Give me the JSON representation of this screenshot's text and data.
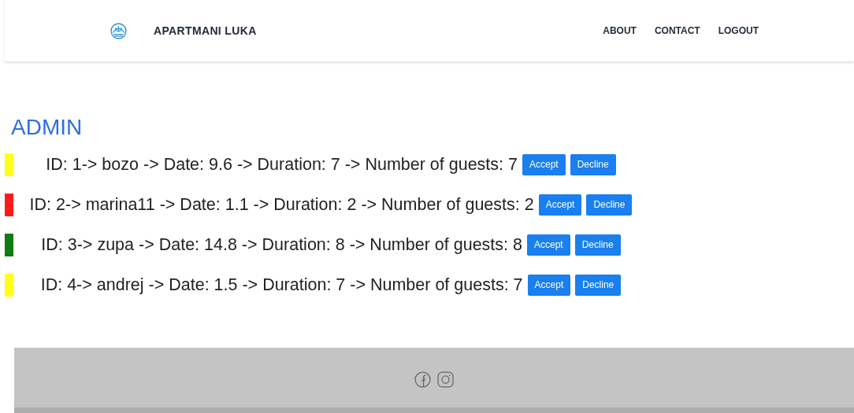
{
  "header": {
    "brand": "APARTMANI LUKA",
    "nav": [
      "ABOUT",
      "CONTACT",
      "LOGOUT"
    ]
  },
  "title": "ADMIN",
  "reservations": [
    {
      "text": "ID: 1-> bozo -> Date: 9.6 -> Duration: 7 -> Number of guests: 7",
      "color": "#ffff1a",
      "actions": [
        "Accept",
        "Decline"
      ]
    },
    {
      "text": "ID: 2-> marina11 -> Date: 1.1 -> Duration: 2 -> Number of guests: 2",
      "color": "#ff1a1a",
      "actions": [
        "Accept",
        "Decline"
      ]
    },
    {
      "text": "ID: 3-> zupa -> Date: 14.8 -> Duration: 8 -> Number of guests: 8",
      "color": "#117a11",
      "actions": [
        "Accept",
        "Decline"
      ]
    },
    {
      "text": "ID: 4-> andrej -> Date: 1.5 -> Duration: 7 -> Number of guests: 7",
      "color": "#ffff1a",
      "actions": [
        "Accept",
        "Decline"
      ]
    }
  ]
}
